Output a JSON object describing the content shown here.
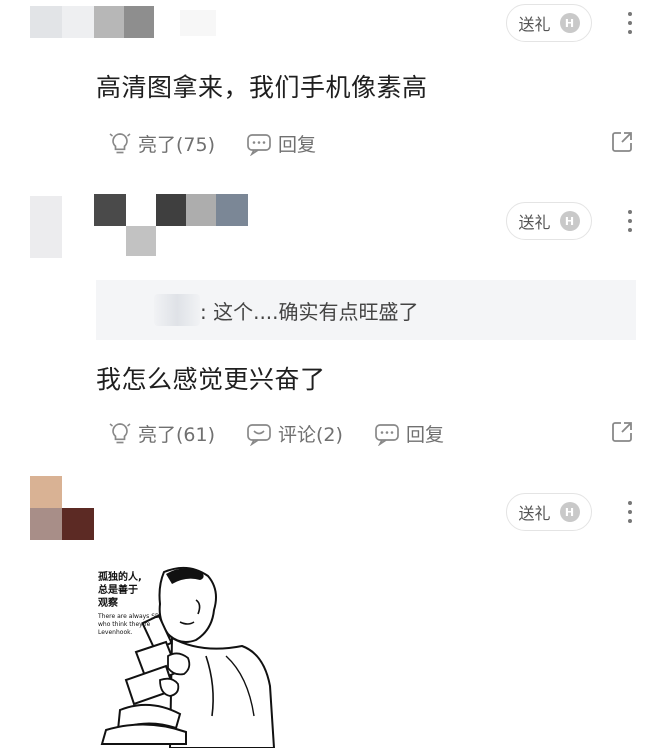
{
  "comments": [
    {
      "gift_label": "送礼",
      "badge": "H",
      "text": "高清图拿来，我们手机像素高",
      "actions": {
        "like": "亮了(75)",
        "reply": "回复"
      }
    },
    {
      "gift_label": "送礼",
      "badge": "H",
      "quote": ": 这个....确实有点旺盛了",
      "text": "我怎么感觉更兴奋了",
      "actions": {
        "like": "亮了(61)",
        "comments": "评论(2)",
        "reply": "回复"
      }
    },
    {
      "gift_label": "送礼",
      "badge": "H",
      "meme": {
        "title_line1": "孤独的人,",
        "title_line2": "总是善于",
        "title_line3": "观察",
        "subtitle_line1": "There are always SB",
        "subtitle_line2": "who think they're",
        "subtitle_line3": "Levenhook."
      }
    }
  ]
}
